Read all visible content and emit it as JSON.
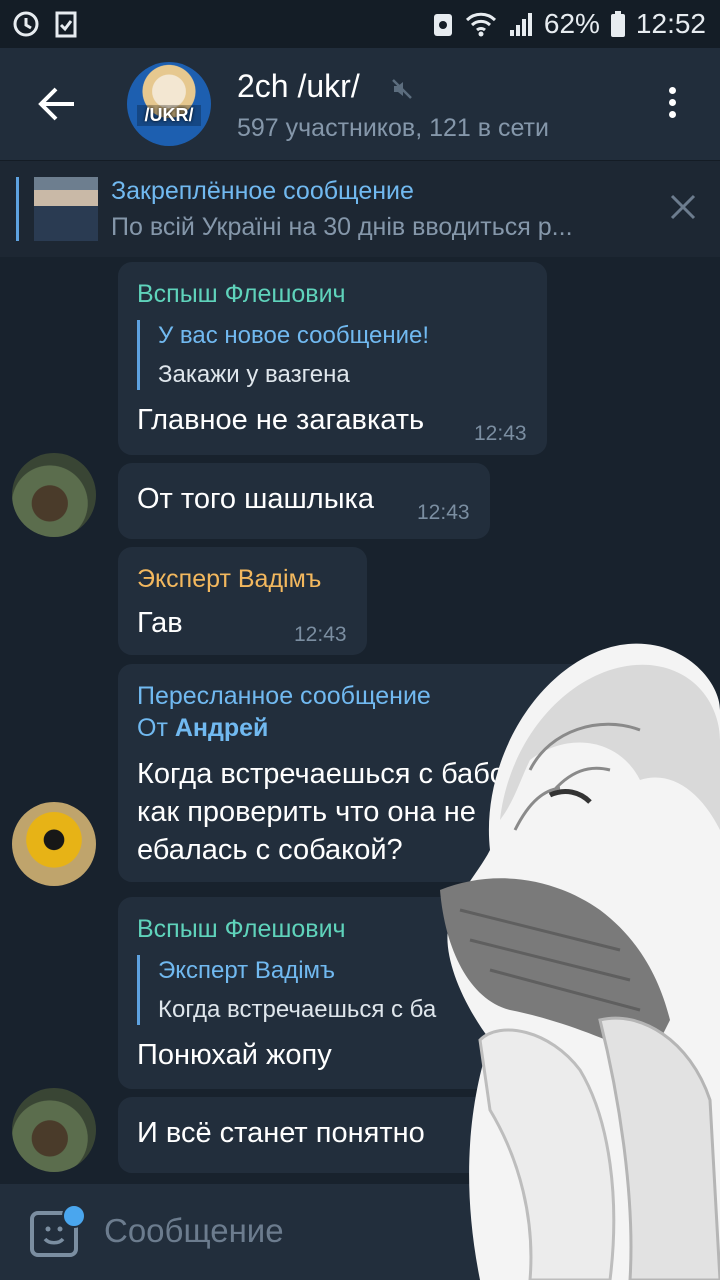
{
  "status_bar": {
    "battery": "62%",
    "time": "12:52"
  },
  "header": {
    "title": "2ch /ukr/",
    "avatar_text": "/UKR/",
    "subtitle": "597 участников, 121 в сети"
  },
  "pinned": {
    "title": "Закреплённое сообщение",
    "text": "По всій Україні на 30 днів вводиться р..."
  },
  "messages": [
    {
      "sender": "Вспыш Флешович",
      "sender_color": "#5fd3bb",
      "reply_title": "У вас новое сообщение!",
      "reply_text": "Закажи у вазгена",
      "text": "Главное не загавкать",
      "time": "12:43"
    },
    {
      "text": "От того шашлыка",
      "time": "12:43"
    },
    {
      "sender": "Эксперт Вадімъ",
      "sender_color": "#f3b85e",
      "text": "Гав",
      "time": "12:43"
    },
    {
      "forward_label": "Пересланное сообщение",
      "forward_from_prefix": "От",
      "forward_from": "Андрей",
      "lines": [
        "Когда встречаешься с бабо",
        "как проверить что она не",
        "ебалась с собакой?"
      ]
    },
    {
      "sender": "Вспыш Флешович",
      "sender_color": "#5fd3bb",
      "reply_title": "Эксперт Вадімъ",
      "reply_text": "Когда встречаешься с ба",
      "text": "Понюхай жопу"
    },
    {
      "text": "И всё станет понятно"
    }
  ],
  "input": {
    "placeholder": "Сообщение"
  },
  "colors": {
    "accent": "#5ea2e0",
    "background": "#18222d",
    "bubble": "#222e3c"
  }
}
